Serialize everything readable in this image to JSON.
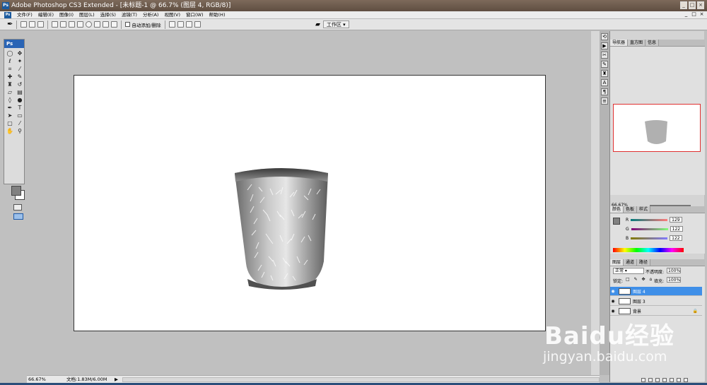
{
  "window": {
    "title": "Adobe Photoshop CS3 Extended - [未标题-1 @ 66.7% (图层 4, RGB/8)]",
    "minimize": "_",
    "restore": "□",
    "close": "×"
  },
  "menu": [
    "文件(F)",
    "编辑(E)",
    "图像(I)",
    "图层(L)",
    "选择(S)",
    "滤镜(T)",
    "分析(A)",
    "视图(V)",
    "窗口(W)",
    "帮助(H)"
  ],
  "options": {
    "auto_delete": "自动添加/删除",
    "workspace": "工作区"
  },
  "toolbox": {
    "logo": "Ps"
  },
  "statusbar": {
    "zoom": "66.67%",
    "doc": "文档:1.83M/6.00M"
  },
  "navigator": {
    "tabs": [
      "导航器",
      "直方图",
      "信息"
    ],
    "zoom": "66.67%"
  },
  "color_panel": {
    "tabs": [
      "颜色",
      "色板",
      "样式"
    ],
    "r": "129",
    "g": "122",
    "b": "122",
    "r_label": "R",
    "g_label": "G",
    "b_label": "B"
  },
  "layers_panel": {
    "tabs": [
      "图层",
      "通道",
      "路径"
    ],
    "blend": "正常",
    "opacity_label": "不透明度:",
    "opacity": "100%",
    "lock_label": "锁定:",
    "fill_label": "填充:",
    "fill": "100%",
    "layers": [
      {
        "name": "图层 4",
        "selected": true
      },
      {
        "name": "图层 3",
        "selected": false
      },
      {
        "name": "背景",
        "selected": false
      }
    ]
  },
  "watermark": {
    "line1": "Baidu经验",
    "line2": "jingyan.baidu.com"
  },
  "colors": {
    "foreground": "#818181",
    "selected_layer": "#3f8fe8"
  }
}
